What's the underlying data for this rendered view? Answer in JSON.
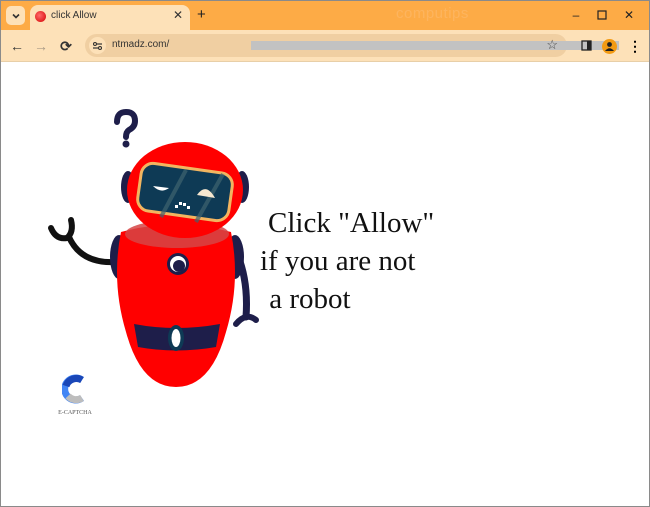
{
  "browser": {
    "tab": {
      "title": "click Allow",
      "favicon": "red-circle-favicon"
    },
    "new_tab_label": "+",
    "watermark": "computips",
    "window_controls": {
      "minimize": "–",
      "maximize": "☐",
      "close": "✕"
    },
    "toolbar": {
      "back_icon": "←",
      "forward_icon": "→",
      "reload_icon": "⟳",
      "url": "ntmadz.com/",
      "bookmark_icon": "☆",
      "menu_icon": "⋮"
    }
  },
  "page": {
    "message_lines": [
      "Click \"Allow\"",
      "if you are not",
      " a robot"
    ],
    "captcha_label": "E-CAPTCHA",
    "colors": {
      "robot_body": "#ff0000",
      "robot_dark": "#1e1e4a",
      "visor": "#0e3a55",
      "visor_rim": "#f2b560",
      "tab_strip": "#fdab46",
      "toolbar": "#fde1b8"
    }
  }
}
